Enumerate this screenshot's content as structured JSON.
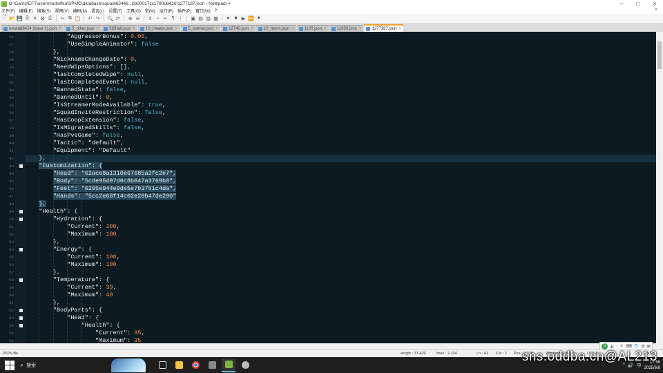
{
  "window": {
    "title": "D:\\Game\\EFT\\user\\mods\\fika\\SPMC\\database\\squad\\63446...bb00017cc1780d8416\\1277187.json - Notepad++",
    "minimize": "–",
    "maximize": "□",
    "close": "×"
  },
  "menu": {
    "items": [
      "文件(F)",
      "编辑(E)",
      "搜索(S)",
      "视图(V)",
      "编码(N)",
      "语言(L)",
      "设置(T)",
      "工具(O)",
      "宏(M)",
      "运行(R)",
      "插件(P)",
      "窗口(W)",
      "?"
    ],
    "close_glyph": "×"
  },
  "tabs": [
    {
      "label": "newtab8424 (base-1).json",
      "active": false
    },
    {
      "label": "5_other.json",
      "active": false
    },
    {
      "label": "5t2Hall.json",
      "active": false
    },
    {
      "label": "10_Heads.json",
      "active": false
    },
    {
      "label": "5_kolmer.json",
      "active": false
    },
    {
      "label": "12740.json",
      "active": false
    },
    {
      "label": "10_items.json",
      "active": false
    },
    {
      "label": "1120.json",
      "active": false
    },
    {
      "label": "12850.json",
      "active": false
    },
    {
      "label": "1277187.json",
      "active": true
    }
  ],
  "editor": {
    "lines": [
      {
        "n": 26,
        "indent": 12,
        "tokens": [
          [
            "k",
            "\"AggressorBonus\""
          ],
          [
            "p",
            ": "
          ],
          [
            "num",
            "0.05"
          ],
          [
            "p",
            ","
          ]
        ]
      },
      {
        "n": 27,
        "indent": 12,
        "tokens": [
          [
            "k",
            "\"UseSimpleAnimator\""
          ],
          [
            "p",
            ": "
          ],
          [
            "bool",
            "false"
          ]
        ]
      },
      {
        "n": 28,
        "indent": 8,
        "tokens": [
          [
            "p",
            "},"
          ]
        ]
      },
      {
        "n": 29,
        "indent": 8,
        "tokens": [
          [
            "k",
            "\"NicknameChangeDate\""
          ],
          [
            "p",
            ": "
          ],
          [
            "num",
            "0"
          ],
          [
            "p",
            ","
          ]
        ]
      },
      {
        "n": 30,
        "indent": 8,
        "tokens": [
          [
            "k",
            "\"NeedWipeOptions\""
          ],
          [
            "p",
            ": [],"
          ]
        ]
      },
      {
        "n": 31,
        "indent": 8,
        "tokens": [
          [
            "k",
            "\"lastCompletedWipe\""
          ],
          [
            "p",
            ": "
          ],
          [
            "nul",
            "null"
          ],
          [
            "p",
            ","
          ]
        ]
      },
      {
        "n": 32,
        "indent": 8,
        "tokens": [
          [
            "k",
            "\"lastCompletedEvent\""
          ],
          [
            "p",
            ": "
          ],
          [
            "nul",
            "null"
          ],
          [
            "p",
            ","
          ]
        ]
      },
      {
        "n": 33,
        "indent": 8,
        "tokens": [
          [
            "k",
            "\"BannedState\""
          ],
          [
            "p",
            ": "
          ],
          [
            "bool",
            "false"
          ],
          [
            "p",
            ","
          ]
        ]
      },
      {
        "n": 34,
        "indent": 8,
        "tokens": [
          [
            "k",
            "\"BannedUntil\""
          ],
          [
            "p",
            ": "
          ],
          [
            "num",
            "0"
          ],
          [
            "p",
            ","
          ]
        ]
      },
      {
        "n": 35,
        "indent": 8,
        "tokens": [
          [
            "k",
            "\"IsStreamerModeAvailable\""
          ],
          [
            "p",
            ": "
          ],
          [
            "bool",
            "true"
          ],
          [
            "p",
            ","
          ]
        ]
      },
      {
        "n": 36,
        "indent": 8,
        "tokens": [
          [
            "k",
            "\"SquadInviteRestriction\""
          ],
          [
            "p",
            ": "
          ],
          [
            "bool",
            "false"
          ],
          [
            "p",
            ","
          ]
        ]
      },
      {
        "n": 37,
        "indent": 8,
        "tokens": [
          [
            "k",
            "\"HasCoopExtension\""
          ],
          [
            "p",
            ": "
          ],
          [
            "bool",
            "false"
          ],
          [
            "p",
            ","
          ]
        ]
      },
      {
        "n": 38,
        "indent": 8,
        "tokens": [
          [
            "k",
            "\"IsMigratedSkills\""
          ],
          [
            "p",
            ": "
          ],
          [
            "bool",
            "false"
          ],
          [
            "p",
            ","
          ]
        ]
      },
      {
        "n": 39,
        "indent": 8,
        "tokens": [
          [
            "k",
            "\"HasPveGame\""
          ],
          [
            "p",
            ": "
          ],
          [
            "bool",
            "false"
          ],
          [
            "p",
            ","
          ]
        ]
      },
      {
        "n": 40,
        "indent": 8,
        "tokens": [
          [
            "k",
            "\"Tactic\""
          ],
          [
            "p",
            ": "
          ],
          [
            "s",
            "\"default\""
          ],
          [
            "p",
            ","
          ]
        ]
      },
      {
        "n": 41,
        "indent": 8,
        "tokens": [
          [
            "k",
            "\"Equipment\""
          ],
          [
            "p",
            ": "
          ],
          [
            "s",
            "\"Default\""
          ]
        ]
      },
      {
        "n": 42,
        "indent": 4,
        "tokens": [
          [
            "p",
            "},"
          ]
        ]
      },
      {
        "n": 43,
        "indent": 4,
        "tokens": [
          [
            "k",
            "\"Customization\""
          ],
          [
            "p",
            ": {"
          ]
        ]
      },
      {
        "n": 44,
        "indent": 8,
        "tokens": [
          [
            "k",
            "\"Head\""
          ],
          [
            "p",
            ": "
          ],
          [
            "s",
            "\"62ace8a1310e67685a2fc2e7\""
          ],
          [
            "p",
            ","
          ]
        ]
      },
      {
        "n": 45,
        "indent": 8,
        "tokens": [
          [
            "k",
            "\"Body\""
          ],
          [
            "p",
            ": "
          ],
          [
            "s",
            "\"5cde95d97d6c8b647a3769b0\""
          ],
          [
            "p",
            ","
          ]
        ]
      },
      {
        "n": 46,
        "indent": 8,
        "tokens": [
          [
            "k",
            "\"Feet\""
          ],
          [
            "p",
            ": "
          ],
          [
            "s",
            "\"6295e944e9de5e7b3751c4da\""
          ],
          [
            "p",
            ","
          ]
        ]
      },
      {
        "n": 47,
        "indent": 8,
        "tokens": [
          [
            "k",
            "\"Hands\""
          ],
          [
            "p",
            ": "
          ],
          [
            "s",
            "\"5cc2e68f14c02e28b47de290\""
          ]
        ]
      },
      {
        "n": 48,
        "indent": 4,
        "tokens": [
          [
            "p",
            "},"
          ]
        ]
      },
      {
        "n": 49,
        "indent": 4,
        "tokens": [
          [
            "k",
            "\"Health\""
          ],
          [
            "p",
            ": {"
          ]
        ]
      },
      {
        "n": 50,
        "indent": 8,
        "tokens": [
          [
            "k",
            "\"Hydration\""
          ],
          [
            "p",
            ": {"
          ]
        ]
      },
      {
        "n": 51,
        "indent": 12,
        "tokens": [
          [
            "k",
            "\"Current\""
          ],
          [
            "p",
            ": "
          ],
          [
            "num",
            "100"
          ],
          [
            "p",
            ","
          ]
        ]
      },
      {
        "n": 52,
        "indent": 12,
        "tokens": [
          [
            "k",
            "\"Maximum\""
          ],
          [
            "p",
            ": "
          ],
          [
            "num",
            "100"
          ]
        ]
      },
      {
        "n": 53,
        "indent": 8,
        "tokens": [
          [
            "p",
            "},"
          ]
        ]
      },
      {
        "n": 54,
        "indent": 8,
        "tokens": [
          [
            "k",
            "\"Energy\""
          ],
          [
            "p",
            ": {"
          ]
        ]
      },
      {
        "n": 55,
        "indent": 12,
        "tokens": [
          [
            "k",
            "\"Current\""
          ],
          [
            "p",
            ": "
          ],
          [
            "num",
            "100"
          ],
          [
            "p",
            ","
          ]
        ]
      },
      {
        "n": 56,
        "indent": 12,
        "tokens": [
          [
            "k",
            "\"Maximum\""
          ],
          [
            "p",
            ": "
          ],
          [
            "num",
            "100"
          ]
        ]
      },
      {
        "n": 57,
        "indent": 8,
        "tokens": [
          [
            "p",
            "},"
          ]
        ]
      },
      {
        "n": 58,
        "indent": 8,
        "tokens": [
          [
            "k",
            "\"Temperature\""
          ],
          [
            "p",
            ": {"
          ]
        ]
      },
      {
        "n": 59,
        "indent": 12,
        "tokens": [
          [
            "k",
            "\"Current\""
          ],
          [
            "p",
            ": "
          ],
          [
            "num",
            "39"
          ],
          [
            "p",
            ","
          ]
        ]
      },
      {
        "n": 60,
        "indent": 12,
        "tokens": [
          [
            "k",
            "\"Maximum\""
          ],
          [
            "p",
            ": "
          ],
          [
            "num",
            "40"
          ]
        ]
      },
      {
        "n": 61,
        "indent": 8,
        "tokens": [
          [
            "p",
            "},"
          ]
        ]
      },
      {
        "n": 62,
        "indent": 8,
        "tokens": [
          [
            "k",
            "\"BodyParts\""
          ],
          [
            "p",
            ": {"
          ]
        ]
      },
      {
        "n": 63,
        "indent": 12,
        "tokens": [
          [
            "k",
            "\"Head\""
          ],
          [
            "p",
            ": {"
          ]
        ]
      },
      {
        "n": 64,
        "indent": 16,
        "tokens": [
          [
            "k",
            "\"Health\""
          ],
          [
            "p",
            ": {"
          ]
        ]
      },
      {
        "n": 65,
        "indent": 20,
        "tokens": [
          [
            "k",
            "\"Current\""
          ],
          [
            "p",
            ": "
          ],
          [
            "num",
            "35"
          ],
          [
            "p",
            ","
          ]
        ]
      },
      {
        "n": 66,
        "indent": 20,
        "tokens": [
          [
            "k",
            "\"Maximum\""
          ],
          [
            "p",
            ": "
          ],
          [
            "num",
            "35"
          ]
        ]
      }
    ],
    "fold_lines": [
      43,
      49,
      50,
      54,
      58,
      62,
      63,
      64
    ],
    "current_line": 42,
    "selected_lines": [
      43,
      44,
      45,
      46,
      47,
      48
    ]
  },
  "status": {
    "lang": "JSON file",
    "length": "length : 37,429",
    "lines": "lines : 2,104",
    "pos": "Ln : 41",
    "col": "Col : 2",
    "sel": "Pos : 2,218",
    "eol": "Windows (CR LF)",
    "enc": "UTF-8",
    "mode": "INS"
  },
  "ime": {
    "logo": "S",
    "items": [
      "五",
      "·",
      "☺",
      "⌨",
      "👕",
      "⚙",
      "⊞"
    ]
  },
  "taskbar": {
    "search_placeholder": "搜索",
    "clock_time": "17:58",
    "clock_date": "2025/6/8",
    "tray": [
      "^",
      "🔊",
      "中"
    ]
  },
  "watermark": "sns.oddba.cn@AL213"
}
